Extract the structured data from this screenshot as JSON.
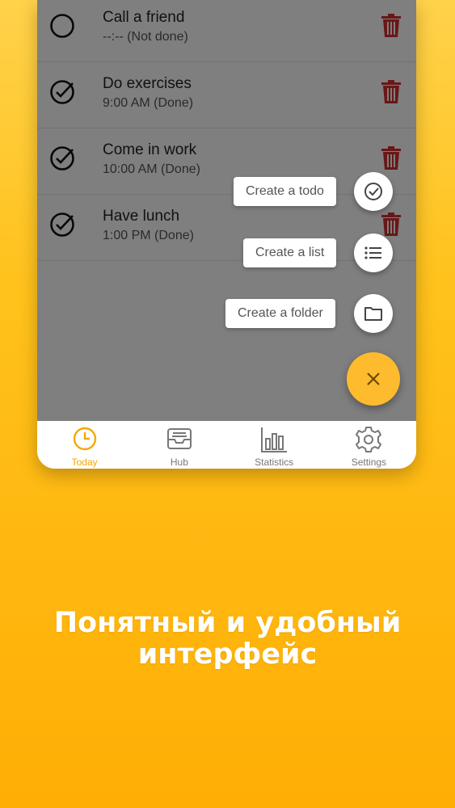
{
  "todos": [
    {
      "title": "Call a  friend",
      "subtitle": "--:-- (Not done)",
      "done": false
    },
    {
      "title": "Do exercises",
      "subtitle": "9:00 AM (Done)",
      "done": true
    },
    {
      "title": "Come in work",
      "subtitle": "10:00 AM (Done)",
      "done": true
    },
    {
      "title": "Have lunch",
      "subtitle": "1:00 PM (Done)",
      "done": true
    }
  ],
  "fab_menu": {
    "create_todo": "Create a todo",
    "create_list": "Create a list",
    "create_folder": "Create a folder"
  },
  "tabs": [
    {
      "label": "Today",
      "icon": "clock-icon",
      "active": true
    },
    {
      "label": "Hub",
      "icon": "inbox-icon",
      "active": false
    },
    {
      "label": "Statistics",
      "icon": "bar-chart-icon",
      "active": false
    },
    {
      "label": "Settings",
      "icon": "gear-icon",
      "active": false
    }
  ],
  "promo": {
    "line1": "Понятный и удобный",
    "line2": "интерфейс"
  },
  "colors": {
    "accent": "#fdbb2d",
    "delete": "#d32f2f",
    "active_tab": "#f5a800"
  }
}
